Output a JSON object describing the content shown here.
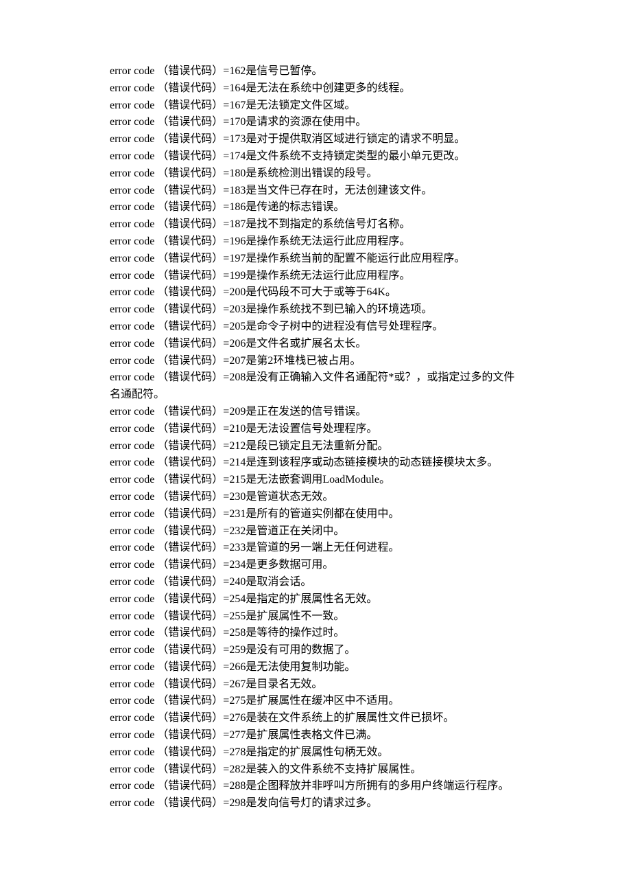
{
  "prefix": "error code （错误代码）=",
  "connector": "是",
  "entries": [
    {
      "code": "162",
      "desc": "信号已暂停。"
    },
    {
      "code": "164",
      "desc": "无法在系统中创建更多的线程。"
    },
    {
      "code": "167",
      "desc": "无法锁定文件区域。"
    },
    {
      "code": "170",
      "desc": "请求的资源在使用中。"
    },
    {
      "code": "173",
      "desc": "对于提供取消区域进行锁定的请求不明显。"
    },
    {
      "code": "174",
      "desc": "文件系统不支持锁定类型的最小单元更改。"
    },
    {
      "code": "180",
      "desc": "系统检测出错误的段号。"
    },
    {
      "code": "183",
      "desc": "当文件已存在时，无法创建该文件。"
    },
    {
      "code": "186",
      "desc": "传递的标志错误。"
    },
    {
      "code": "187",
      "desc": "找不到指定的系统信号灯名称。"
    },
    {
      "code": "196",
      "desc": "操作系统无法运行此应用程序。"
    },
    {
      "code": "197",
      "desc": "操作系统当前的配置不能运行此应用程序。"
    },
    {
      "code": "199",
      "desc": "操作系统无法运行此应用程序。"
    },
    {
      "code": "200",
      "desc": "代码段不可大于或等于64K。"
    },
    {
      "code": "203",
      "desc": "操作系统找不到已输入的环境选项。"
    },
    {
      "code": "205",
      "desc": "命令子树中的进程没有信号处理程序。"
    },
    {
      "code": "206",
      "desc": "文件名或扩展名太长。"
    },
    {
      "code": "207",
      "desc": "第2环堆栈已被占用。"
    },
    {
      "code": "208",
      "desc": "没有正确输入文件名通配符*或？，或指定过多的文件名通配符。"
    },
    {
      "code": "209",
      "desc": "正在发送的信号错误。"
    },
    {
      "code": "210",
      "desc": "无法设置信号处理程序。"
    },
    {
      "code": "212",
      "desc": "段已锁定且无法重新分配。"
    },
    {
      "code": "214",
      "desc": "连到该程序或动态链接模块的动态链接模块太多。"
    },
    {
      "code": "215",
      "desc": "无法嵌套调用LoadModule。"
    },
    {
      "code": "230",
      "desc": "管道状态无效。"
    },
    {
      "code": "231",
      "desc": "所有的管道实例都在使用中。"
    },
    {
      "code": "232",
      "desc": "管道正在关闭中。"
    },
    {
      "code": "233",
      "desc": "管道的另一端上无任何进程。"
    },
    {
      "code": "234",
      "desc": "更多数据可用。"
    },
    {
      "code": "240",
      "desc": "取消会话。"
    },
    {
      "code": "254",
      "desc": "指定的扩展属性名无效。"
    },
    {
      "code": "255",
      "desc": "扩展属性不一致。"
    },
    {
      "code": "258",
      "desc": "等待的操作过时。"
    },
    {
      "code": "259",
      "desc": "没有可用的数据了。"
    },
    {
      "code": "266",
      "desc": "无法使用复制功能。"
    },
    {
      "code": "267",
      "desc": "目录名无效。"
    },
    {
      "code": "275",
      "desc": "扩展属性在缓冲区中不适用。"
    },
    {
      "code": "276",
      "desc": "装在文件系统上的扩展属性文件已损坏。"
    },
    {
      "code": "277",
      "desc": "扩展属性表格文件已满。"
    },
    {
      "code": "278",
      "desc": "指定的扩展属性句柄无效。"
    },
    {
      "code": "282",
      "desc": "装入的文件系统不支持扩展属性。"
    },
    {
      "code": "288",
      "desc": "企图释放并非呼叫方所拥有的多用户终端运行程序。"
    },
    {
      "code": "298",
      "desc": "发向信号灯的请求过多。"
    }
  ]
}
